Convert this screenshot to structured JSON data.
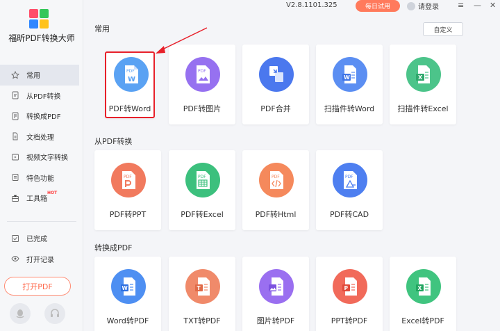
{
  "app": {
    "name": "福昕PDF转换大师",
    "version": "V2.8.1101.325",
    "trial_label": "每日试用",
    "login_label": "请登录"
  },
  "window": {
    "menu_glyph": "≡",
    "minimize_glyph": "—",
    "close_glyph": "✕"
  },
  "sidebar": {
    "items": [
      {
        "label": "常用",
        "icon": "star-icon"
      },
      {
        "label": "从PDF转换",
        "icon": "doc-out-icon"
      },
      {
        "label": "转换成PDF",
        "icon": "doc-in-icon"
      },
      {
        "label": "文档处理",
        "icon": "doc-icon"
      },
      {
        "label": "视频文字转换",
        "icon": "video-icon"
      },
      {
        "label": "特色功能",
        "icon": "feature-icon"
      },
      {
        "label": "工具箱",
        "icon": "toolbox-icon",
        "badge": "HOT"
      }
    ],
    "bottom_items": [
      {
        "label": "已完成",
        "icon": "check-icon"
      },
      {
        "label": "打开记录",
        "icon": "eye-icon"
      }
    ],
    "open_pdf_label": "打开PDF"
  },
  "sections": {
    "common": {
      "title": "常用",
      "custom_label": "自定义",
      "cards": [
        {
          "label": "PDF转Word",
          "color": "#4e9af1",
          "icon": "pdf-word-icon",
          "highlighted": true
        },
        {
          "label": "PDF转图片",
          "color": "#8f6ef0",
          "icon": "pdf-image-icon"
        },
        {
          "label": "PDF合并",
          "color": "#4b78ee",
          "icon": "pdf-merge-icon"
        },
        {
          "label": "扫描件转Word",
          "color": "#5b8ef2",
          "icon": "scan-word-icon"
        },
        {
          "label": "扫描件转Excel",
          "color": "#4cc48a",
          "icon": "scan-excel-icon"
        }
      ]
    },
    "from_pdf": {
      "title": "从PDF转换",
      "cards": [
        {
          "label": "PDF转PPT",
          "color": "#f17a5e",
          "icon": "pdf-ppt-icon"
        },
        {
          "label": "PDF转Excel",
          "color": "#3cc07d",
          "icon": "pdf-excel-icon"
        },
        {
          "label": "PDF转Html",
          "color": "#f5895c",
          "icon": "pdf-html-icon"
        },
        {
          "label": "PDF转CAD",
          "color": "#4e7ff0",
          "icon": "pdf-cad-icon"
        }
      ]
    },
    "to_pdf": {
      "title": "转换成PDF",
      "cards": [
        {
          "label": "Word转PDF",
          "color": "#4e8ff2",
          "icon": "word-pdf-icon"
        },
        {
          "label": "TXT转PDF",
          "color": "#f08a6a",
          "icon": "txt-pdf-icon"
        },
        {
          "label": "图片转PDF",
          "color": "#9a6ff0",
          "icon": "image-pdf-icon"
        },
        {
          "label": "PPT转PDF",
          "color": "#f16a5a",
          "icon": "ppt-pdf-icon"
        },
        {
          "label": "Excel转PDF",
          "color": "#40c47f",
          "icon": "excel-pdf-icon"
        }
      ]
    }
  },
  "annotation": {
    "arrow_color": "#e8202a"
  }
}
